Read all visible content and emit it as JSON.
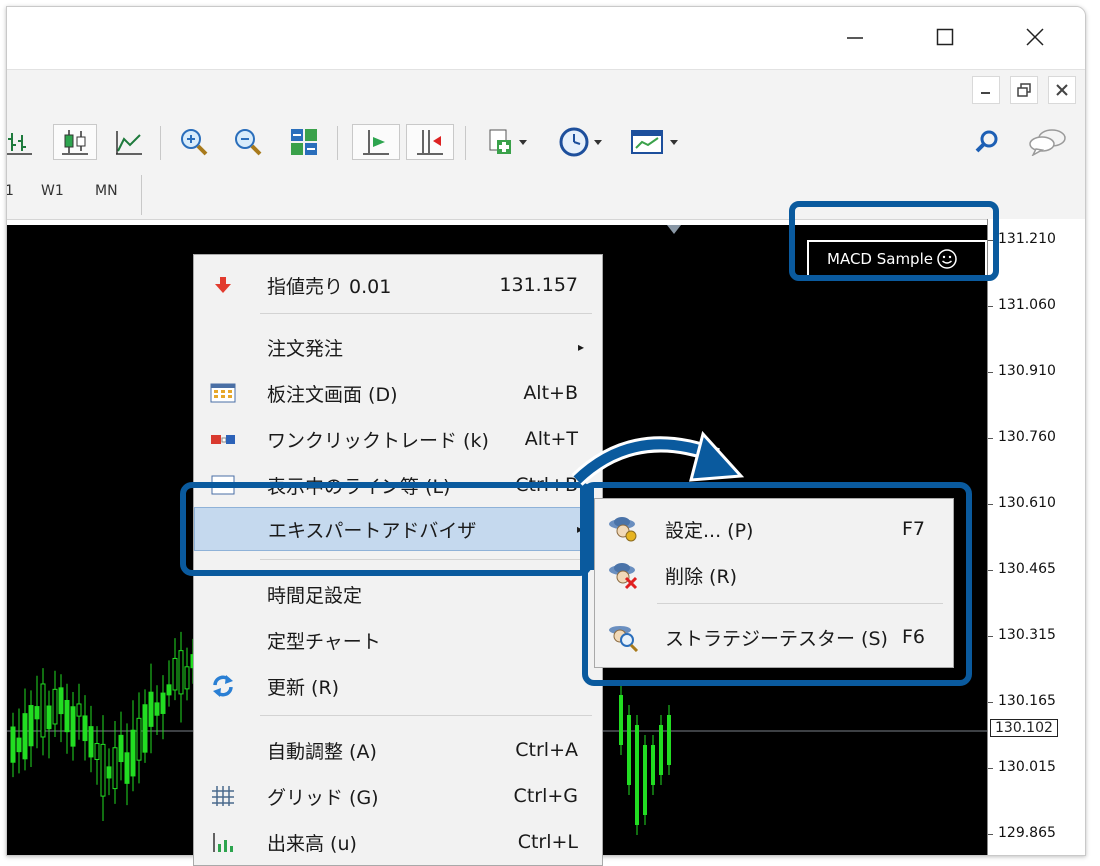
{
  "mdi_buttons": [
    "minimize",
    "restore",
    "close"
  ],
  "timeframes": [
    "1",
    "W1",
    "MN"
  ],
  "price_scale": [
    "131.210",
    "131.060",
    "130.910",
    "130.760",
    "130.610",
    "130.465",
    "130.315",
    "130.165",
    "130.015",
    "129.865"
  ],
  "current_price": "130.102",
  "expert_label": "MACD Sample",
  "context_menu": {
    "items": [
      {
        "label": "指値売り 0.01",
        "shortcut": "131.157"
      },
      {
        "label": "注文発注",
        "shortcut": "▸"
      },
      {
        "label": "板注文画面 (D)",
        "shortcut": "Alt+B"
      },
      {
        "label": "ワンクリックトレード (k)",
        "shortcut": "Alt+T"
      },
      {
        "label": "表示中のライン等 (L)",
        "shortcut": "Ctrl+B"
      },
      {
        "label": "エキスパートアドバイザ",
        "shortcut": "▸"
      },
      {
        "label": "時間足設定",
        "shortcut": ""
      },
      {
        "label": "定型チャート",
        "shortcut": ""
      },
      {
        "label": "更新 (R)",
        "shortcut": ""
      },
      {
        "label": "自動調整 (A)",
        "shortcut": "Ctrl+A"
      },
      {
        "label": "グリッド (G)",
        "shortcut": "Ctrl+G"
      },
      {
        "label": "出来高 (u)",
        "shortcut": "Ctrl+L"
      }
    ]
  },
  "submenu": {
    "items": [
      {
        "label": "設定... (P)",
        "shortcut": "F7"
      },
      {
        "label": "削除 (R)",
        "shortcut": ""
      },
      {
        "label": "ストラテジーテスター (S)",
        "shortcut": "F6"
      }
    ]
  },
  "colors": {
    "chart_bg": "#000000",
    "candles": "#22dd22",
    "highlight": "#0a5a9e",
    "menu_selected": "#c5d9ee"
  }
}
